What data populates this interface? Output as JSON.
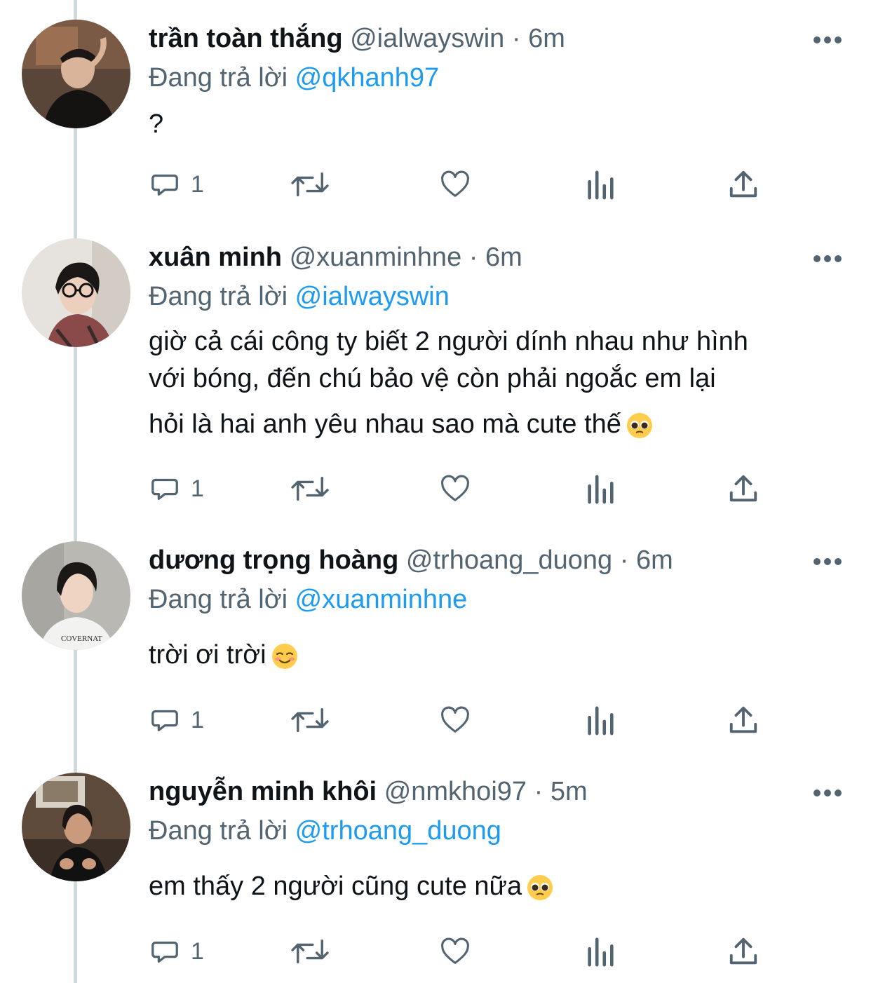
{
  "tweets": [
    {
      "name": "trần toàn thắng",
      "handle": "@ialwayswin",
      "separator": "·",
      "time": "6m",
      "replying_prefix": "Đang trả lời",
      "replying_to": "@qkhanh97",
      "lines": [
        "?"
      ],
      "emoji": "",
      "reply_count": "1"
    },
    {
      "name": "xuân minh",
      "handle": "@xuanminhne",
      "separator": "·",
      "time": "6m",
      "replying_prefix": "Đang trả lời",
      "replying_to": "@ialwayswin",
      "lines": [
        "giờ cả cái công ty biết 2 người dính nhau như hình",
        "với bóng, đến chú bảo vệ còn phải ngoắc em lại",
        "hỏi là hai anh yêu nhau sao mà cute thế"
      ],
      "emoji": "pleading-face",
      "reply_count": "1"
    },
    {
      "name": "dương trọng hoàng",
      "handle": "@trhoang_duong",
      "separator": "·",
      "time": "6m",
      "replying_prefix": "Đang trả lời",
      "replying_to": "@xuanminhne",
      "lines": [
        "trời ơi trời"
      ],
      "emoji": "smiling-face",
      "reply_count": "1"
    },
    {
      "name": "nguyễn minh khôi",
      "handle": "@nmkhoi97",
      "separator": "·",
      "time": "5m",
      "replying_prefix": "Đang trả lời",
      "replying_to": "@trhoang_duong",
      "lines": [
        "em thấy 2 người cũng cute nữa"
      ],
      "emoji": "pleading-face",
      "reply_count": "1"
    }
  ],
  "colors": {
    "text": "#0f1419",
    "secondary": "#536471",
    "link": "#1d9bf0",
    "thread_line": "#cfd9de"
  },
  "icons": [
    "reply-icon",
    "retweet-icon",
    "like-icon",
    "analytics-icon",
    "share-icon",
    "more-icon"
  ]
}
